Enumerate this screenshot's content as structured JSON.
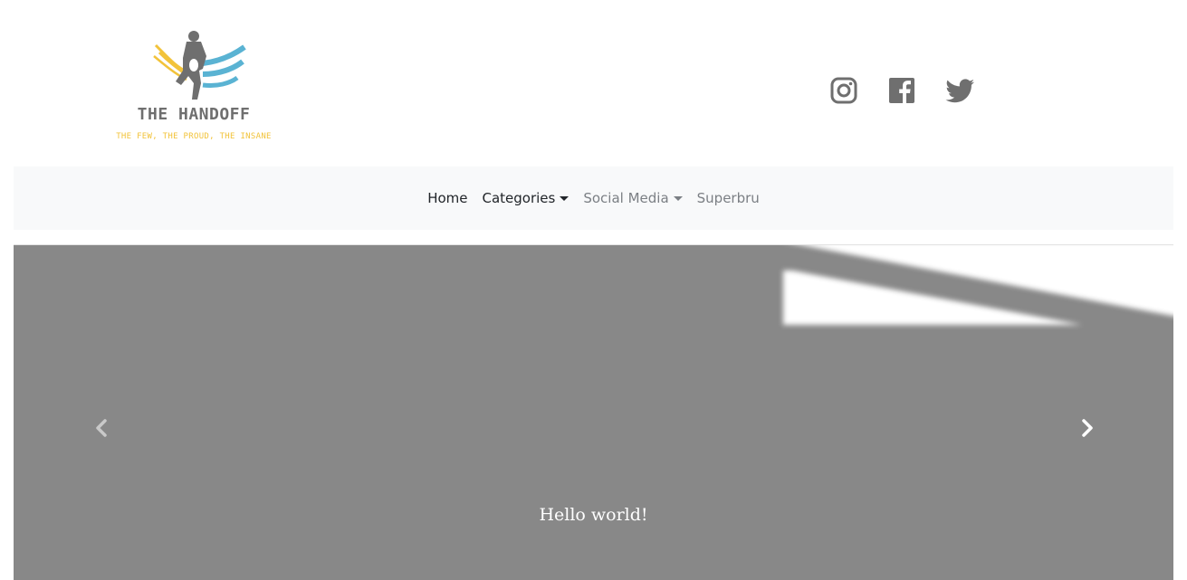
{
  "brand": {
    "title": "THE HANDOFF",
    "tagline": "THE FEW, THE PROUD, THE INSANE",
    "colors": {
      "grey": "#6f6f6f",
      "yellow": "#f2c33a",
      "blue": "#5ab3d3"
    }
  },
  "social": [
    {
      "icon": "instagram-icon",
      "name": "Instagram"
    },
    {
      "icon": "facebook-icon",
      "name": "Facebook"
    },
    {
      "icon": "twitter-icon",
      "name": "Twitter"
    }
  ],
  "nav": {
    "items": [
      {
        "label": "Home",
        "dropdown": false
      },
      {
        "label": "Categories",
        "dropdown": true
      },
      {
        "label": "Social Media",
        "dropdown": true
      },
      {
        "label": "Superbru",
        "dropdown": false
      }
    ]
  },
  "carousel": {
    "caption": "Hello world!",
    "prev_icon": "chevron-left-icon",
    "next_icon": "chevron-right-icon",
    "background_color": "#888888"
  }
}
